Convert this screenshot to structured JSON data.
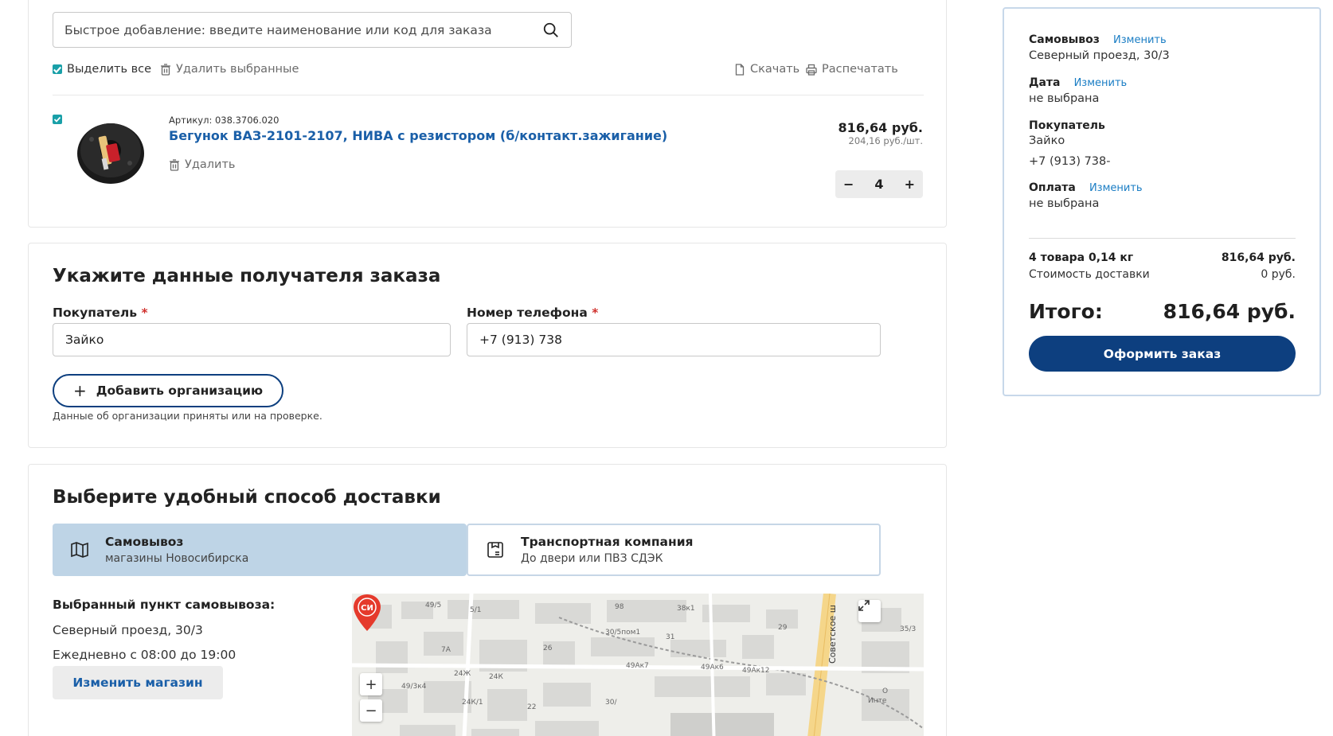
{
  "cart": {
    "quick_add_placeholder": "Быстрое добавление: введите наименование или код для заказа",
    "select_all_label": "Выделить все",
    "delete_selected_label": "Удалить выбранные",
    "download_label": "Скачать",
    "print_label": "Распечатать",
    "items": [
      {
        "article": "Артикул: 038.3706.020",
        "name": "Бегунок ВАЗ-2101-2107, НИВА с резистором (б/контакт.зажигание)",
        "delete_label": "Удалить",
        "price": "816,64 руб.",
        "unit_price": "204,16 руб./шт.",
        "minus": "−",
        "quantity": "4",
        "plus": "+"
      }
    ]
  },
  "recipient": {
    "title": "Укажите данные получателя заказа",
    "buyer_label": "Покупатель",
    "phone_label": "Номер телефона",
    "required_mark": "*",
    "buyer_value": "Зайко",
    "phone_value": "+7 (913) 738",
    "add_org_plus": "+",
    "add_org_label": "Добавить организацию",
    "org_note": "Данные об организации приняты или на проверке."
  },
  "delivery": {
    "title": "Выберите удобный способ доставки",
    "options": [
      {
        "title": "Самовывоз",
        "subtitle": "магазины Новосибирска",
        "icon": "map-icon"
      },
      {
        "title": "Транспортная компания",
        "subtitle": "До двери или ПВЗ СДЭК",
        "icon": "box-icon"
      }
    ],
    "pickup_title": "Выбранный пункт самовывоза:",
    "pickup_address": "Северный проезд, 30/3",
    "pickup_hours": "Ежедневно с 08:00 до 19:00",
    "change_store_label": "Изменить магазин",
    "map": {
      "road_label": "Советское ш",
      "labels": [
        "49/5",
        "5/1",
        "98",
        "38к1",
        "29",
        "35/3",
        "30/5пом1",
        "31",
        "7А",
        "26",
        "49Ак7",
        "49Ак6",
        "49Ак12",
        "24Ж",
        "24К",
        "49/3к4",
        "24К/1",
        "22",
        "30/",
        "О",
        "Инте"
      ],
      "zoom_in": "+",
      "zoom_out": "−"
    }
  },
  "summary": {
    "pickup_label": "Самовывоз",
    "change_link": "Изменить",
    "pickup_address": "Северный проезд, 30/3",
    "date_label": "Дата",
    "date_value": "не выбрана",
    "buyer_label": "Покупатель",
    "buyer_name": "Зайко",
    "buyer_phone": "+7 (913) 738-",
    "payment_label": "Оплата",
    "payment_value": "не выбрана",
    "goods_label": "4 товара 0,14 кг",
    "goods_value": "816,64 руб.",
    "delivery_label": "Стоимость доставки",
    "delivery_value": "0 руб.",
    "total_label": "Итого:",
    "total_value": "816,64 руб.",
    "checkout_label": "Оформить заказ"
  },
  "colors": {
    "accent": "#0d3f7f",
    "link": "#1a5fa8",
    "checkbox": "#19a0a8",
    "selected_option": "#bed4e6",
    "required": "#d0312d"
  }
}
